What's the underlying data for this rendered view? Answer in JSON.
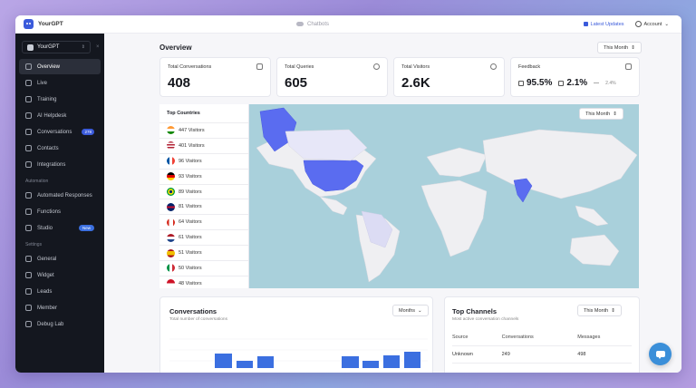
{
  "app": {
    "name": "YourGPT",
    "center_tab": "Chatbots",
    "updates_label": "Latest Updates",
    "account_label": "Account"
  },
  "sidebar": {
    "workspace": "YourGPT",
    "items_main": [
      {
        "label": "Overview",
        "icon": "grid-icon",
        "active": true
      },
      {
        "label": "Live",
        "icon": "live-icon"
      },
      {
        "label": "Training",
        "icon": "book-icon"
      },
      {
        "label": "AI Helpdesk",
        "icon": "helpdesk-icon"
      },
      {
        "label": "Conversations",
        "icon": "chat-icon",
        "badge": "278"
      },
      {
        "label": "Contacts",
        "icon": "contacts-icon"
      },
      {
        "label": "Integrations",
        "icon": "integrations-icon"
      }
    ],
    "automation_heading": "Automation",
    "items_automation": [
      {
        "label": "Automated Responses",
        "icon": "reply-icon"
      },
      {
        "label": "Functions",
        "icon": "function-icon"
      },
      {
        "label": "Studio",
        "icon": "studio-icon",
        "badge": "New"
      }
    ],
    "settings_heading": "Settings",
    "items_settings": [
      {
        "label": "General",
        "icon": "gear-icon"
      },
      {
        "label": "Widget",
        "icon": "widget-icon"
      },
      {
        "label": "Leads",
        "icon": "leads-icon"
      },
      {
        "label": "Member",
        "icon": "member-icon"
      },
      {
        "label": "Debug Lab",
        "icon": "debug-icon"
      }
    ]
  },
  "overview": {
    "title": "Overview",
    "period": "This Month",
    "stats": [
      {
        "label": "Total Conversations",
        "value": "408",
        "icon": "message-icon"
      },
      {
        "label": "Total Queries",
        "value": "605",
        "icon": "question-icon"
      },
      {
        "label": "Total Visitors",
        "value": "2.6K",
        "icon": "users-icon"
      }
    ],
    "feedback": {
      "label": "Feedback",
      "positive": "95.5%",
      "negative": "2.1%",
      "neutral": "2.4%",
      "icon": "document-icon"
    }
  },
  "countries": {
    "title": "Top Countries",
    "period": "This Month",
    "rows": [
      {
        "label": "447 Visitors",
        "flag": "india"
      },
      {
        "label": "401 Visitors",
        "flag": "usa"
      },
      {
        "label": "96 Visitors",
        "flag": "france"
      },
      {
        "label": "93 Visitors",
        "flag": "germany"
      },
      {
        "label": "89 Visitors",
        "flag": "brazil"
      },
      {
        "label": "81 Visitors",
        "flag": "uk"
      },
      {
        "label": "64 Visitors",
        "flag": "canada"
      },
      {
        "label": "61 Visitors",
        "flag": "netherlands"
      },
      {
        "label": "51 Visitors",
        "flag": "spain"
      },
      {
        "label": "50 Visitors",
        "flag": "italy"
      },
      {
        "label": "48 Visitors",
        "flag": "indonesia"
      }
    ]
  },
  "conversations_card": {
    "title": "Conversations",
    "subtitle": "Total number of conversations",
    "period": "Months"
  },
  "top_channels": {
    "title": "Top Channels",
    "subtitle": "Most active conversation channels",
    "period": "This Month",
    "headers": [
      "Source",
      "Conversations",
      "Messages"
    ],
    "rows": [
      {
        "source": "Unknown",
        "conversations": "249",
        "messages": "498"
      }
    ]
  },
  "colors": {
    "accent": "#3b5bdb",
    "map_highlight": "#5a6cf0",
    "sidebar_bg": "#14171f"
  }
}
